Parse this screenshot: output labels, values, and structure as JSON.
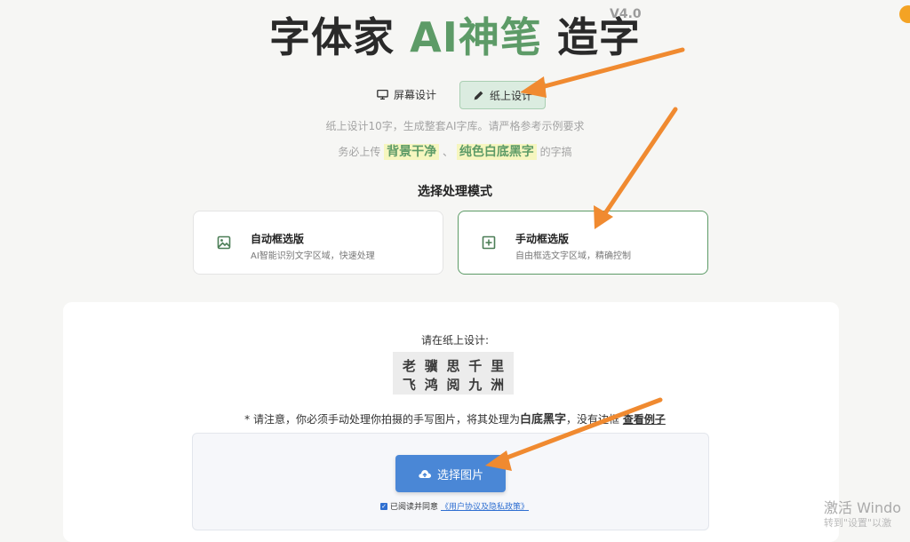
{
  "header": {
    "title_part1": "字体家",
    "title_ai": "AI神笔",
    "title_part2": "造字",
    "version": "V4.0"
  },
  "mode_tabs": [
    {
      "label": "屏幕设计",
      "icon": "monitor-icon",
      "active": false
    },
    {
      "label": "纸上设计",
      "icon": "pencil-icon",
      "active": true
    }
  ],
  "hints": {
    "line1": "纸上设计10字，生成整套AI字库。请严格参考示例要求",
    "line2_prefix": "务必上传",
    "highlight1": "背景干净",
    "separator": "、",
    "highlight2": "纯色白底黑字",
    "line2_suffix": "的字搞"
  },
  "processing": {
    "title": "选择处理模式",
    "options": [
      {
        "title": "自动框选版",
        "desc": "AI智能识别文字区域，快速处理",
        "icon": "image-icon",
        "active": false
      },
      {
        "title": "手动框选版",
        "desc": "自由框选文字区域，精确控制",
        "icon": "plus-square-icon",
        "active": true
      }
    ]
  },
  "design": {
    "prompt": "请在纸上设计:",
    "row1": [
      "老",
      "骥",
      "思",
      "千",
      "里"
    ],
    "row2": [
      "飞",
      "鸿",
      "阅",
      "九",
      "洲"
    ]
  },
  "notice": {
    "prefix": "* 请注意，你必须手动处理你拍摄的手写图片，将其处理为",
    "bold": "白底黑字",
    "suffix": "，没有边框 ",
    "link": "查看例子"
  },
  "upload": {
    "button_label": "选择图片",
    "button_icon": "cloud-upload-icon",
    "agree_prefix": "已阅读并同意",
    "agree_link": "《用户协议及隐私政策》",
    "agree_checked": true
  },
  "watermark": {
    "line1": "激活 Windo",
    "line2": "转到\"设置\"以激"
  },
  "colors": {
    "accent_green": "#5d9b67",
    "button_blue": "#4a87d6",
    "arrow_orange": "#f08a30",
    "highlight_yellow": "#f6f6bf"
  }
}
